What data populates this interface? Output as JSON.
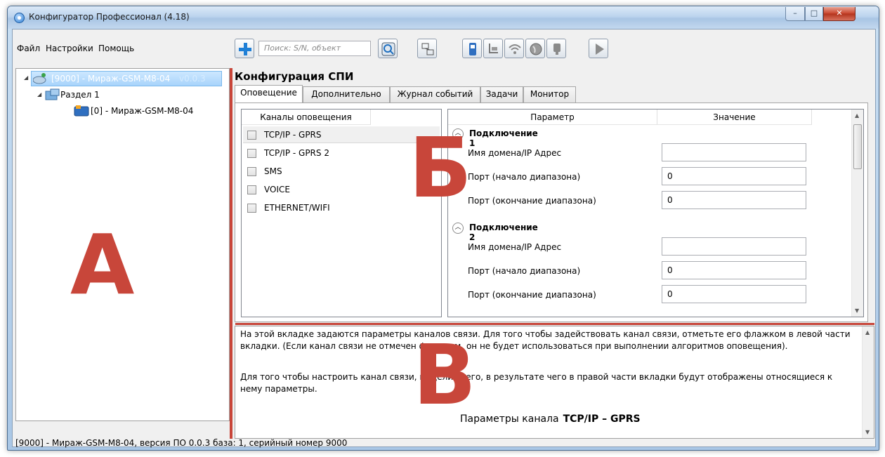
{
  "window": {
    "title": "Конфигуратор Профессионал (4.18)",
    "min": "–",
    "max": "□",
    "close": "✕"
  },
  "menu": [
    "Файл",
    "Настройки",
    "Помощь"
  ],
  "toolbar": {
    "search_placeholder": "Поиск: S/N, объект"
  },
  "tree": {
    "root_label": "[9000] - Мираж-GSM-M8-04",
    "root_version": "v0.0.3",
    "section_label": "Раздел 1",
    "device_label": "[0] - Мираж-GSM-M8-04"
  },
  "panel": {
    "title": "Конфигурация СПИ",
    "tabs": [
      "Оповещение",
      "Дополнительно",
      "Журнал событий",
      "Задачи",
      "Монитор"
    ]
  },
  "channels": {
    "header": "Каналы оповещения",
    "items": [
      "TCP/IP - GPRS",
      "TCP/IP - GPRS 2",
      "SMS",
      "VOICE",
      "ETHERNET/WIFI"
    ]
  },
  "params": {
    "col_param": "Параметр",
    "col_value": "Значение",
    "groups": [
      {
        "title": "Подключение 1",
        "rows": [
          {
            "label": "Имя домена/IP Адрес",
            "value": ""
          },
          {
            "label": "Порт (начало диапазона)",
            "value": "0"
          },
          {
            "label": "Порт (окончание диапазона)",
            "value": "0"
          }
        ]
      },
      {
        "title": "Подключение 2",
        "rows": [
          {
            "label": "Имя домена/IP Адрес",
            "value": ""
          },
          {
            "label": "Порт (начало диапазона)",
            "value": "0"
          },
          {
            "label": "Порт (окончание диапазона)",
            "value": "0"
          }
        ]
      }
    ]
  },
  "description": {
    "p1": "На этой вкладке задаются параметры каналов связи. Для того чтобы задействовать канал связи, отметьте его флажком в левой части вкладки. (Если канал связи не отмечен флажком, он не будет использоваться при выполнении алгоритмов оповещения).",
    "p2": "Для того чтобы настроить канал связи, выделите его, в результате чего в правой части вкладки будут отображены относящиеся к нему параметры.",
    "channel_prefix": "Параметры канала",
    "channel_name": "TCP/IP – GPRS"
  },
  "status": "[9000] - Мираж-GSM-M8-04, версия ПО 0.0.3 база: 1, серийный номер 9000",
  "annotations": {
    "a": "А",
    "b": "Б",
    "v": "В"
  },
  "colors": {
    "annotation": "#c8463a",
    "selection": "#a8d4fb"
  }
}
